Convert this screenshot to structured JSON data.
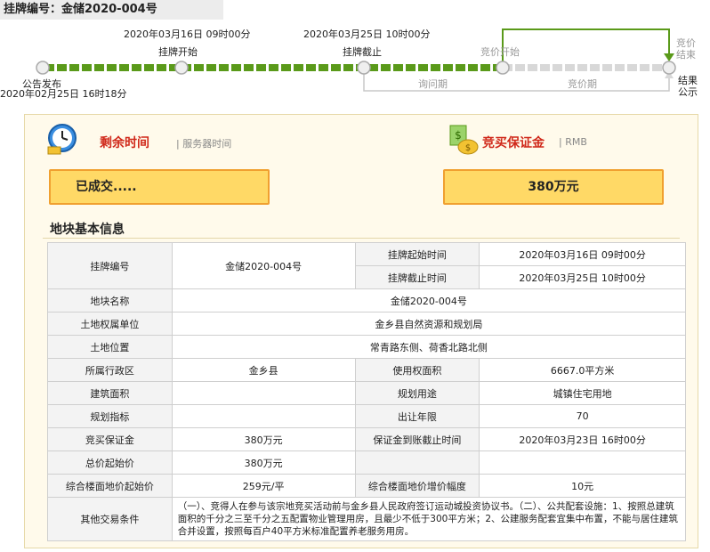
{
  "header": {
    "title": "挂牌编号：金储2020-004号"
  },
  "timeline": {
    "announce": {
      "label": "公告发布",
      "time": "2020年02月25日 16时18分"
    },
    "listing_start": {
      "label": "挂牌开始",
      "time": "2020年03月16日 09时00分"
    },
    "listing_end": {
      "label": "挂牌截止",
      "time": "2020年03月25日 10时00分"
    },
    "bidding_start": {
      "label": "竞价开始"
    },
    "bidding_end": {
      "label": "竞价结束"
    },
    "result": {
      "label": "结果公示"
    },
    "phase_inquiry": "询问期",
    "phase_bidding": "竞价期",
    "colors": {
      "done": "#5a9a1a",
      "pending": "#d8d8d8"
    }
  },
  "status": {
    "remaining_label": "剩余时间",
    "server_time_label": "| 服务器时间",
    "remaining_value": "已成交.....",
    "deposit_label": "竞买保证金",
    "deposit_unit_label": "| RMB",
    "deposit_value": "380万元"
  },
  "section": {
    "title": "地块基本信息"
  },
  "table": {
    "listing_no_k": "挂牌编号",
    "listing_no_v": "金储2020-004号",
    "start_k": "挂牌起始时间",
    "start_v": "2020年03月16日 09时00分",
    "end_k": "挂牌截止时间",
    "end_v": "2020年03月25日 10时00分",
    "name_k": "地块名称",
    "name_v": "金储2020-004号",
    "owner_k": "土地权属单位",
    "owner_v": "金乡县自然资源和规划局",
    "loc_k": "土地位置",
    "loc_v": "常青路东侧、荷香北路北侧",
    "district_k": "所属行政区",
    "district_v": "金乡县",
    "area_k": "使用权面积",
    "area_v": "6667.0平方米",
    "build_k": "建筑面积",
    "build_v": "",
    "use_k": "规划用途",
    "use_v": "城镇住宅用地",
    "index_k": "规划指标",
    "index_v": "",
    "years_k": "出让年限",
    "years_v": "70",
    "deposit_k": "竞买保证金",
    "deposit_v": "380万元",
    "deposit_deadline_k": "保证金到账截止时间",
    "deposit_deadline_v": "2020年03月23日 16时00分",
    "total_k": "总价起始价",
    "total_v": "380万元",
    "floor_k": "综合楼面地价起始价",
    "floor_v": "259元/平",
    "incr_k": "综合楼面地价增价幅度",
    "incr_v": "10元",
    "other_k": "其他交易条件",
    "other_v": "（一）、竞得人在参与该宗地竞买活动前与金乡县人民政府签订运动城投资协议书。（二）、公共配套设施：1、按照总建筑面积的千分之三至千分之五配置物业管理用房，且最少不低于300平方米；2、公建服务配套宜集中布置，不能与居住建筑合并设置，按照每百户40平方米标准配置养老服务用房。"
  }
}
